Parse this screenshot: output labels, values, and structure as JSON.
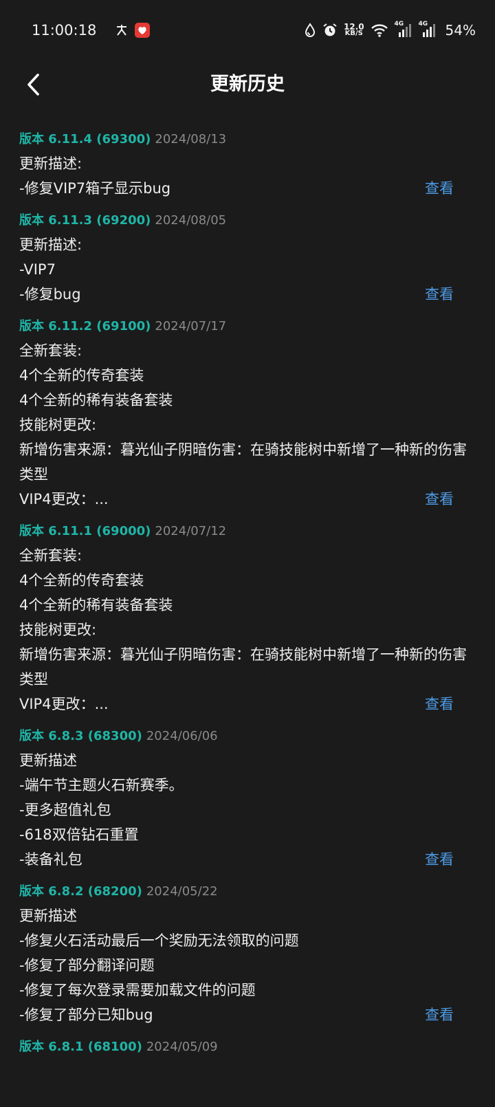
{
  "status_bar": {
    "time": "11:00:18",
    "net_speed_value": "12.0",
    "net_speed_unit": "KB/S",
    "signal_label_1": "4G",
    "signal_label_2": "4G",
    "battery": "54%",
    "icons": [
      "app-icon-1",
      "app-icon-2",
      "drop-icon",
      "alarm-icon",
      "wifi-icon",
      "signal-icon",
      "signal-icon"
    ]
  },
  "header": {
    "title": "更新历史"
  },
  "colors": {
    "background": "#1b1b1b",
    "version": "#1fb5a7",
    "date": "#8a8a8a",
    "link": "#4d9be6"
  },
  "entries": [
    {
      "version": "版本 6.11.4 (69300)",
      "date": "2024/08/13",
      "lines": [
        "更新描述:",
        "-修复VIP7箱子显示bug"
      ],
      "link": "查看"
    },
    {
      "version": "版本 6.11.3 (69200)",
      "date": "2024/08/05",
      "lines": [
        "更新描述:",
        "-VIP7",
        "-修复bug"
      ],
      "link": "查看"
    },
    {
      "version": "版本 6.11.2 (69100)",
      "date": "2024/07/17",
      "lines": [
        "全新套装:",
        "4个全新的传奇套装",
        "4个全新的稀有装备套装",
        "技能树更改:",
        "新增伤害来源：暮光仙子阴暗伤害：在骑技能树中新增了一种新的伤害类型",
        "VIP4更改：..."
      ],
      "link": "查看"
    },
    {
      "version": "版本 6.11.1 (69000)",
      "date": "2024/07/12",
      "lines": [
        "全新套装:",
        "4个全新的传奇套装",
        "4个全新的稀有装备套装",
        "技能树更改:",
        "新增伤害来源：暮光仙子阴暗伤害：在骑技能树中新增了一种新的伤害类型",
        "VIP4更改：..."
      ],
      "link": "查看"
    },
    {
      "version": "版本 6.8.3 (68300)",
      "date": "2024/06/06",
      "lines": [
        "更新描述",
        "-端午节主题火石新赛季。",
        "-更多超值礼包",
        "-618双倍钻石重置",
        "-装备礼包"
      ],
      "link": "查看"
    },
    {
      "version": "版本 6.8.2 (68200)",
      "date": "2024/05/22",
      "lines": [
        "更新描述",
        "-修复火石活动最后一个奖励无法领取的问题",
        "-修复了部分翻译问题",
        "-修复了每次登录需要加载文件的问题",
        "-修复了部分已知bug"
      ],
      "link": "查看"
    },
    {
      "version": "版本 6.8.1 (68100)",
      "date": "2024/05/09",
      "lines": [],
      "link": ""
    }
  ]
}
